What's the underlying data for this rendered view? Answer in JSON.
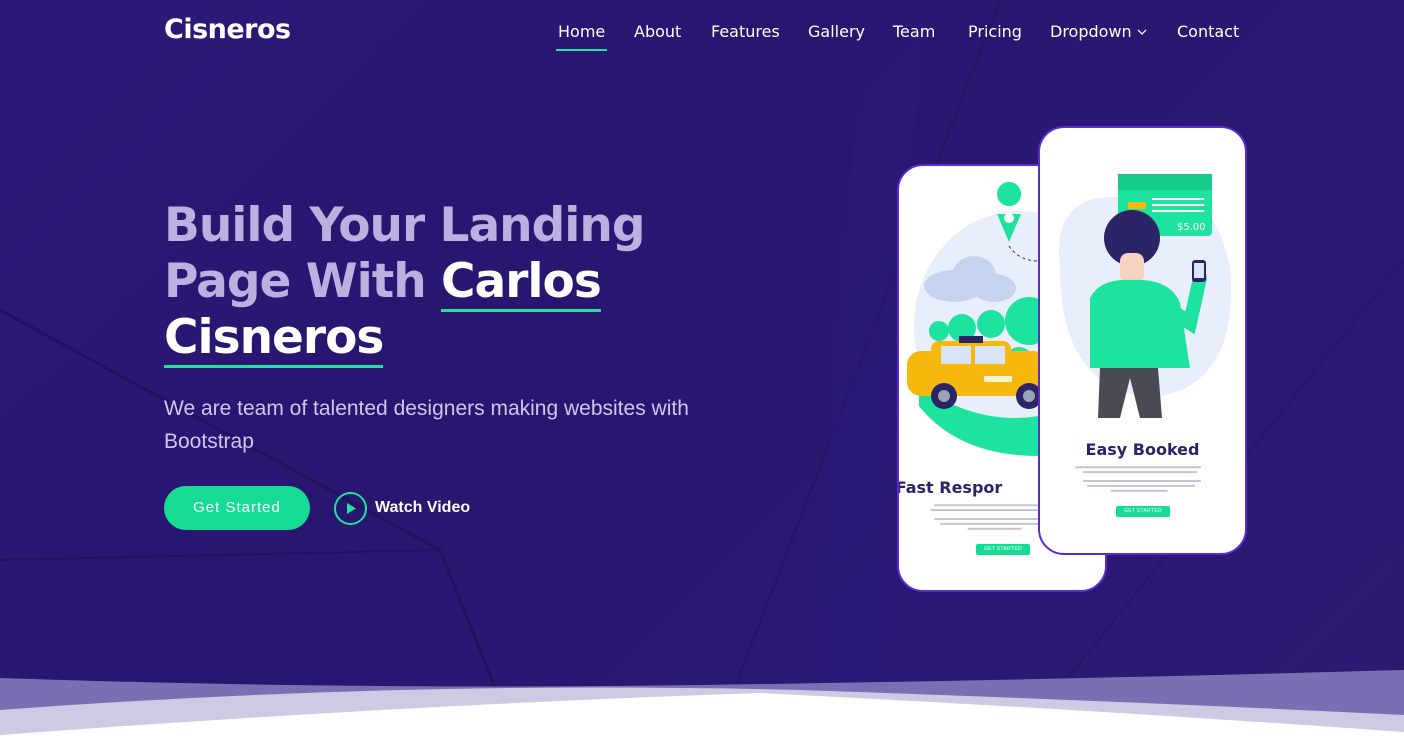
{
  "brand": {
    "logo_text": "Cisneros"
  },
  "nav": {
    "items": [
      {
        "label": "Home",
        "active": true
      },
      {
        "label": "About"
      },
      {
        "label": "Features"
      },
      {
        "label": "Gallery"
      },
      {
        "label": "Team"
      },
      {
        "label": "Pricing"
      },
      {
        "label": "Dropdown",
        "has_dropdown": true
      },
      {
        "label": "Contact"
      }
    ]
  },
  "hero": {
    "headline_part1": "Build Your Landing Page With ",
    "headline_accent1": "Carlos",
    "headline_accent2": "Cisneros",
    "subtitle": "We are team of talented designers making websites with Bootstrap",
    "cta_label": "Get Started",
    "video_label": "Watch Video"
  },
  "phones": {
    "phone1": {
      "title": "Fast Respor",
      "button": "GET STARTED"
    },
    "phone2": {
      "title": "Easy Booked",
      "button": "GET STARTED",
      "price": "$5.00"
    }
  },
  "colors": {
    "background": "#2b1a72",
    "accent": "#1de39f",
    "button": "#16dc93",
    "phone_border": "#5a2bd4"
  }
}
